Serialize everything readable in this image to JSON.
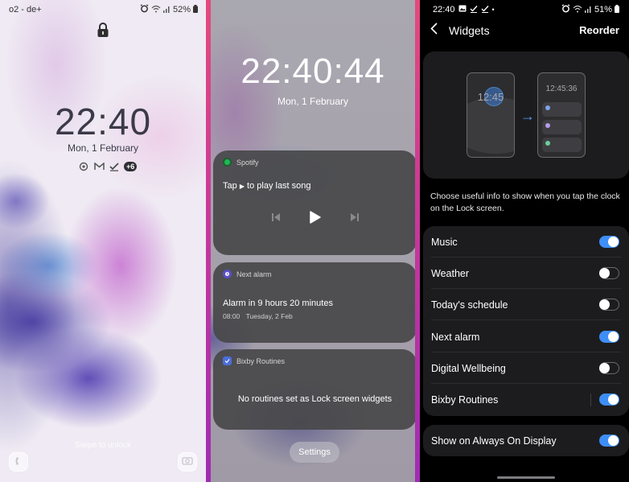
{
  "lock_screen": {
    "status_bar": {
      "carrier": "o2 - de+",
      "icons": [
        "alarm-icon",
        "wifi-icon",
        "signal-icon"
      ],
      "battery": "52%"
    },
    "lock_icon": "lock-icon",
    "time": "22:40",
    "date": "Mon, 1 February",
    "notification_icons": [
      "sync-icon",
      "gmail-icon",
      "tasks-icon"
    ],
    "more_notifications": "+6",
    "swipe_hint": "Swipe to unlock",
    "shortcuts": {
      "left": "phone-icon",
      "right": "camera-icon"
    }
  },
  "widgets_screen": {
    "time": "22:40:44",
    "date": "Mon, 1 February",
    "spotify": {
      "app_name": "Spotify",
      "prompt_prefix": "Tap",
      "prompt_suffix": "to play last song",
      "controls": [
        "previous-icon",
        "play-icon",
        "next-icon"
      ]
    },
    "next_alarm": {
      "app_name": "Next alarm",
      "title": "Alarm in 9 hours 20 minutes",
      "alarm_time": "08:00",
      "alarm_day": "Tuesday, 2 Feb"
    },
    "bixby": {
      "app_name": "Bixby Routines",
      "message": "No routines set as Lock screen widgets"
    },
    "settings_button": "Settings"
  },
  "settings_screen": {
    "status_bar": {
      "time": "22:40",
      "battery": "51%"
    },
    "title": "Widgets",
    "reorder_label": "Reorder",
    "illustration": {
      "before_time": "12:45",
      "after_time": "12:45:36",
      "row_colors": [
        "#7fa4e8",
        "#b79be6",
        "#6ccf9c"
      ]
    },
    "description": "Choose useful info to show when you tap the clock on the Lock screen.",
    "widgets": [
      {
        "label": "Music",
        "enabled": true
      },
      {
        "label": "Weather",
        "enabled": false
      },
      {
        "label": "Today's schedule",
        "enabled": false
      },
      {
        "label": "Next alarm",
        "enabled": true
      },
      {
        "label": "Digital Wellbeing",
        "enabled": false
      },
      {
        "label": "Bixby Routines",
        "enabled": true
      }
    ],
    "always_on_display": {
      "label": "Show on Always On Display",
      "enabled": true
    },
    "accent_color": "#3e8ef7"
  },
  "divider_colors": [
    "#e44a7c",
    "#9f2cb3"
  ]
}
